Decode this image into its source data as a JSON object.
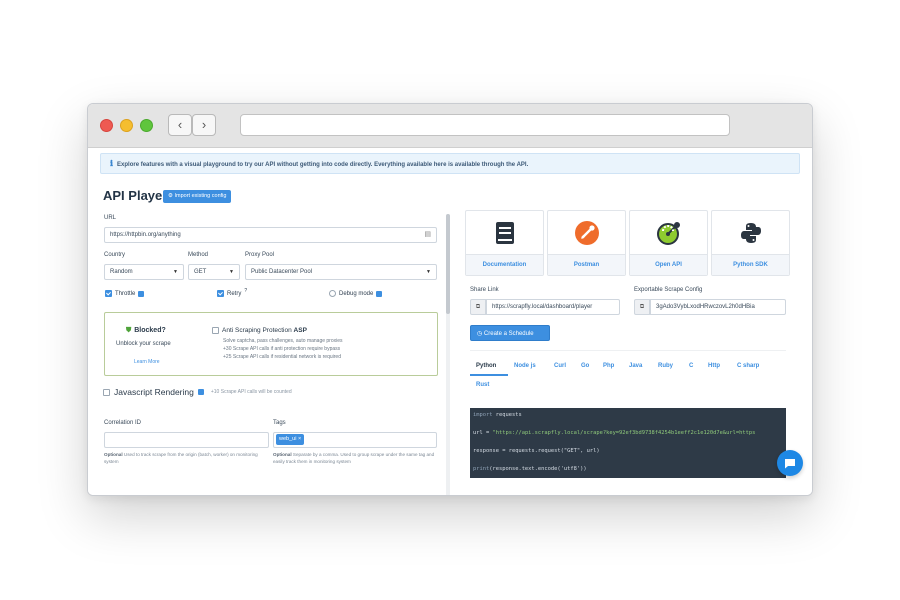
{
  "browser": {
    "back_icon": "chevron-left-icon",
    "forward_icon": "chevron-right-icon",
    "url": ""
  },
  "banner": {
    "icon": "info-icon",
    "text": "Explore features with a visual playground to try our API without getting into code directly. Everything available here is available through the API."
  },
  "player": {
    "title": "API Player",
    "import_button": "Import existing config",
    "url_label": "URL",
    "url_value": "https://httpbin.org/anything",
    "country_label": "Country",
    "country_value": "Random",
    "method_label": "Method",
    "method_value": "GET",
    "proxy_label": "Proxy Pool",
    "proxy_value": "Public Datacenter Pool",
    "throttle_label": "Throttle",
    "throttle_checked": true,
    "retry_label": "Retry",
    "retry_checked": true,
    "debug_label": "Debug mode",
    "debug_checked": false
  },
  "asp": {
    "blocked_title": "Blocked?",
    "blocked_sub": "Unblock your scrape",
    "learn_more": "Learn More",
    "checkbox_prefix": "Anti Scraping Protection",
    "checkbox_bold": "ASP",
    "line1": "Solve captcha, pass challenges, auto manage proxies",
    "line2": "+30 Scrape API calls if anti protection require bypass",
    "line3": "+25 Scrape API calls if residential network is required"
  },
  "js": {
    "label": "Javascript Rendering",
    "note": "+10 Scrape API calls will be counted",
    "checked": false
  },
  "correlation": {
    "label": "Correlation ID",
    "value": "",
    "note_bold": "Optional",
    "note": "Used to track scrape from the origin (batch, worker) on monitoring system"
  },
  "tags": {
    "label": "Tags",
    "chip": "web_ui",
    "chip_close": "×",
    "note_bold": "Optional",
    "note": "Separate by a comma. Used to group scrape under the same tag and easily track them in monitoring system"
  },
  "tools": [
    {
      "label": "Documentation",
      "icon": "book-icon"
    },
    {
      "label": "Postman",
      "icon": "postman-icon"
    },
    {
      "label": "Open API",
      "icon": "openapi-icon"
    },
    {
      "label": "Python SDK",
      "icon": "python-icon"
    }
  ],
  "share": {
    "label": "Share Link",
    "value": "https://scrapfly.local/dashboard/player",
    "copy_icon": "copy-icon"
  },
  "export": {
    "label": "Exportable Scrape Config",
    "value": "3gAdo3VybLxodHRwczovL2h0dHBia",
    "copy_icon": "copy-icon"
  },
  "schedule_button": "Create a Schedule",
  "languages": [
    "Python",
    "Node js",
    "Curl",
    "Go",
    "Php",
    "Java",
    "Ruby",
    "C",
    "Http",
    "C sharp",
    "Rust"
  ],
  "active_language": "Python",
  "code": {
    "line1_kw": "import",
    "line1_rest": " requests",
    "line2_a": "url = ",
    "line2_str": "\"https://api.scrapfly.local/scrape?key=92ef3bd9738f4254b1eeff2c1e120d7e&url=https",
    "line3": "response = requests.request(\"GET\", url)",
    "line4_kw": "print",
    "line4_rest": "(response.text.encode('utf8'))"
  },
  "colors": {
    "accent": "#3d8fe0",
    "asp_border": "#b9cc9a",
    "code_bg": "#2e3a47",
    "chat": "#1e88e5"
  },
  "chat_icon": "chat-bubble-icon"
}
